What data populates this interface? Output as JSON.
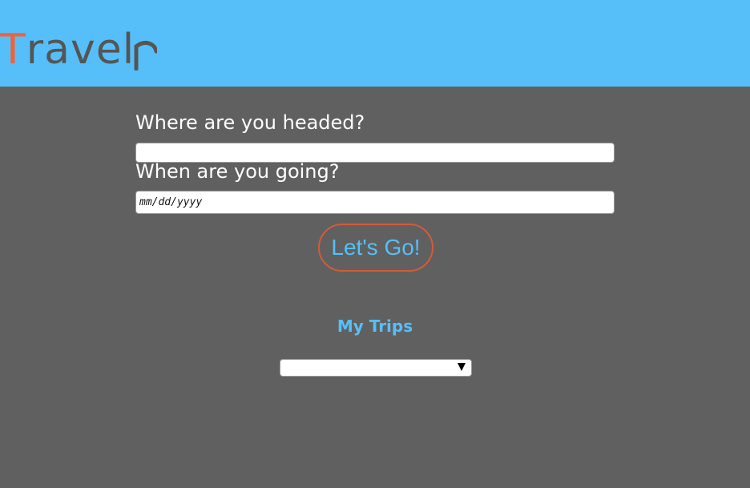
{
  "header": {
    "logo": {
      "first_letter": "T",
      "rest": "ravel",
      "tail_icon": "curved-r-tail-icon"
    }
  },
  "form": {
    "destination_label": "Where are you headed?",
    "destination_value": "",
    "date_label": "When are you going?",
    "date_placeholder": "mm/dd/yyyy",
    "submit_label": "Let's Go!"
  },
  "trips": {
    "title": "My Trips",
    "selected_value": "",
    "dropdown_icon": "triangle-down-icon"
  },
  "colors": {
    "header_bg": "#56bff9",
    "page_bg": "#606060",
    "logo_accent": "#f0623b",
    "logo_text": "#555555",
    "button_border": "#d35b38",
    "accent_text": "#56bff9"
  }
}
